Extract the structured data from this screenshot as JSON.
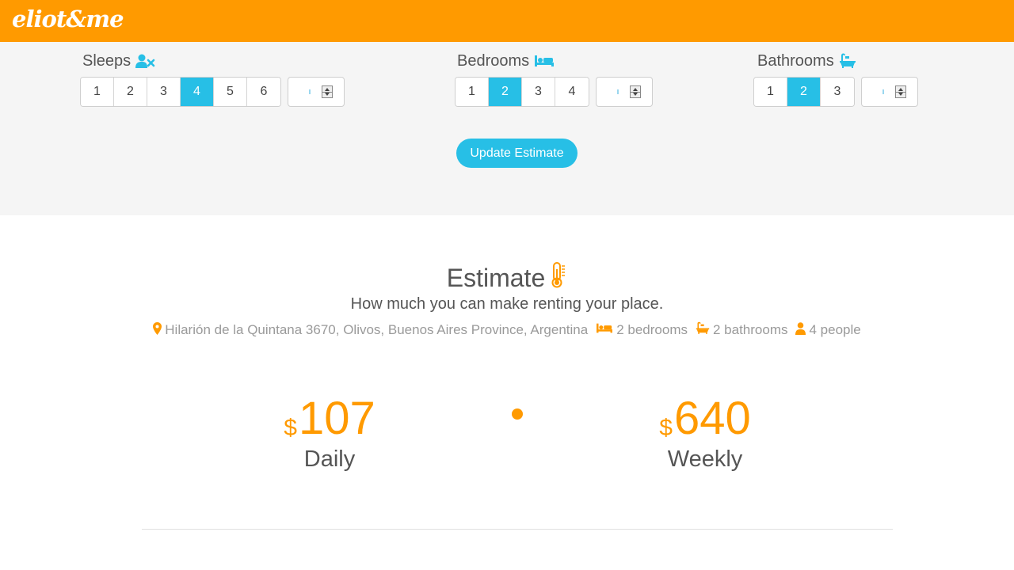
{
  "brand": {
    "logo": "eliot&me"
  },
  "colors": {
    "accent": "#ff9a00",
    "active": "#27bfe6"
  },
  "sleeps": {
    "label": "Sleeps",
    "icon": "user-times-icon",
    "options": [
      "1",
      "2",
      "3",
      "4",
      "5",
      "6"
    ],
    "selected": "4"
  },
  "bedrooms": {
    "label": "Bedrooms",
    "icon": "bed-icon",
    "options": [
      "1",
      "2",
      "3",
      "4"
    ],
    "selected": "2"
  },
  "bathrooms": {
    "label": "Bathrooms",
    "icon": "bath-icon",
    "options": [
      "1",
      "2",
      "3"
    ],
    "selected": "2"
  },
  "update_button": "Update Estimate",
  "estimate": {
    "title": "Estimate",
    "title_icon": "thermometer-icon",
    "subtitle": "How much you can make renting your place.",
    "address": "Hilarión de la Quintana 3670, Olivos, Buenos Aires Province, Argentina",
    "bedrooms": "2 bedrooms",
    "bathrooms": "2 bathrooms",
    "people": "4 people",
    "daily": {
      "currency": "$",
      "amount": "107",
      "label": "Daily"
    },
    "weekly": {
      "currency": "$",
      "amount": "640",
      "label": "Weekly"
    }
  }
}
